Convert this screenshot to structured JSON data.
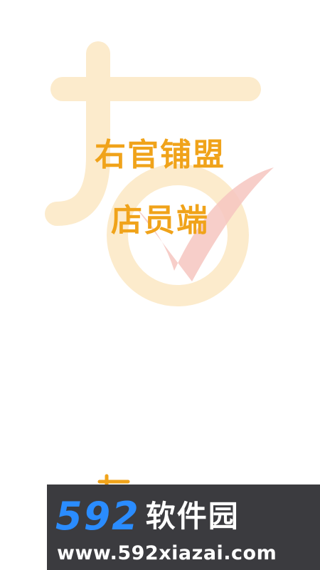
{
  "splash": {
    "title_line1": "右官铺盟",
    "title_line2": "店员端"
  },
  "watermark": {
    "number": "592",
    "name": "软件园",
    "url": "www.592xiazai.com"
  },
  "colors": {
    "brand_orange": "#f0a31a",
    "logo_cream": "#fcebcc",
    "logo_pink": "#f6c6bf",
    "watermark_bg": "#3b3b3f",
    "watermark_blue": "#2a8cff"
  }
}
